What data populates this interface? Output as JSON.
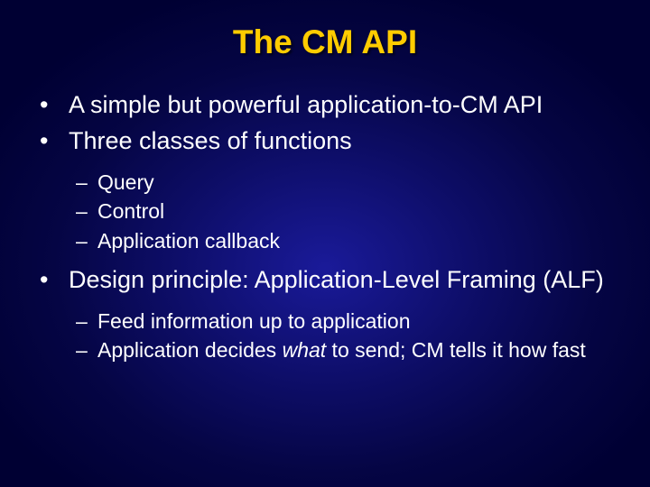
{
  "title": "The CM API",
  "bullets": {
    "b1": "A simple but powerful application-to-CM API",
    "b2": "Three classes of functions",
    "b2a": "Query",
    "b2b": "Control",
    "b2c": "Application callback",
    "b3": "Design principle: Application-Level Framing (ALF)",
    "b3a": "Feed information up to application",
    "b3b_pre": "Application decides ",
    "b3b_em": "what",
    "b3b_post": " to send; CM tells it how fast"
  }
}
